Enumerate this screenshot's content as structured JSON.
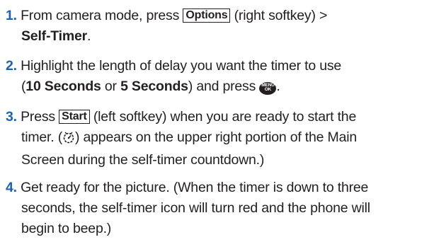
{
  "steps": [
    {
      "number": "1.",
      "text_a": "From camera mode, press",
      "key": "Options",
      "text_b": "(right softkey) >",
      "line2_bold": "Self-Timer",
      "line2_end": "."
    },
    {
      "number": "2.",
      "text_a": "Highlight the length of delay you want the timer to use",
      "paren_open": "(",
      "opt1": "10 Seconds",
      "or": " or ",
      "opt2": "5 Seconds",
      "text_b": ") and press",
      "menu_line1": "MENU",
      "menu_line2": "OK",
      "end": "."
    },
    {
      "number": "3.",
      "text_a": "Press",
      "key": "Start",
      "text_b": "(left softkey) when you are ready to start the",
      "line2_a": "timer. (",
      "line2_b": ") appears on the upper right portion of the Main",
      "line3": "Screen during the self-timer countdown.)"
    },
    {
      "number": "4.",
      "line1": "Get ready for the picture. (When the timer is down to three",
      "line2": "seconds, the self-timer icon will turn red and the phone will",
      "line3": "begin to beep.)"
    }
  ],
  "colors": {
    "step_number": "#1a62b5",
    "text": "#231f20"
  },
  "icons": {
    "menu_ok": "menu-ok-key-icon",
    "timer": "self-timer-icon"
  }
}
